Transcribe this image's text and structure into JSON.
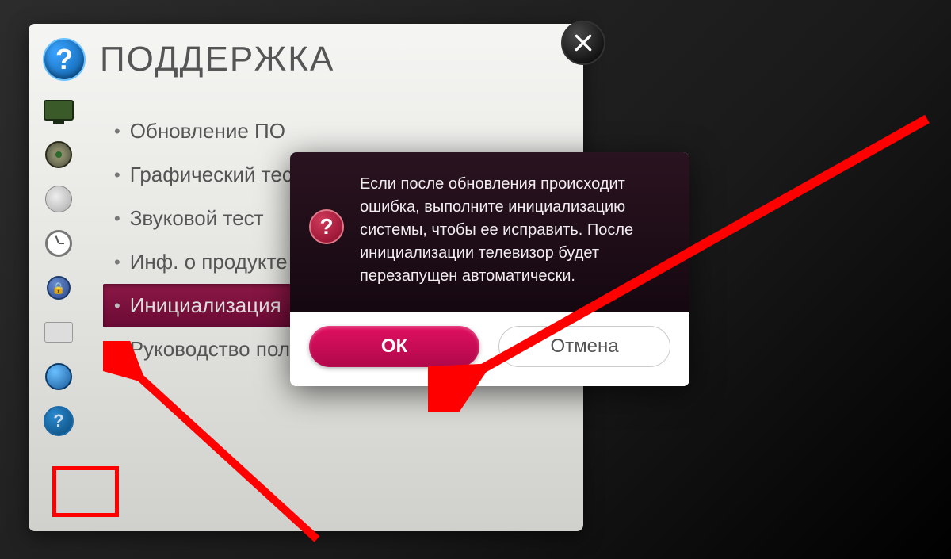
{
  "header": {
    "title": "ПОДДЕРЖКА"
  },
  "menu": {
    "items": [
      {
        "label": "Обновление ПО",
        "selected": false
      },
      {
        "label": "Графический тест",
        "selected": false
      },
      {
        "label": "Звуковой тест",
        "selected": false
      },
      {
        "label": "Инф. о продукте",
        "selected": false
      },
      {
        "label": "Инициализация",
        "selected": true
      },
      {
        "label": "Руководство пользователя",
        "selected": false
      }
    ]
  },
  "dialog": {
    "message": "Если после обновления происходит ошибка, выполните инициализацию системы, чтобы ее исправить. После инициализации телевизор будет перезапущен автоматически.",
    "ok": "ОК",
    "cancel": "Отмена"
  }
}
